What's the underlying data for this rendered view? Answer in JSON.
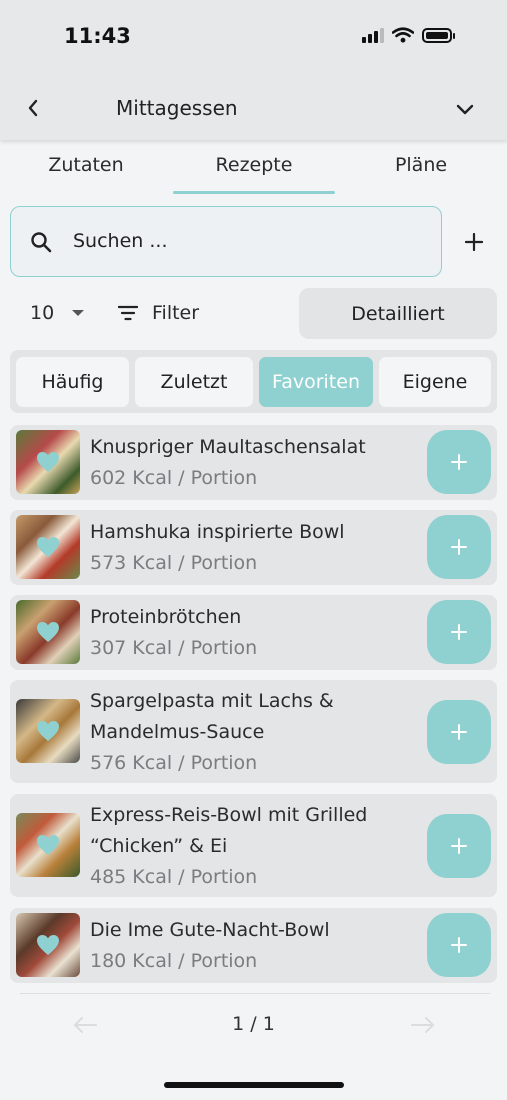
{
  "status": {
    "time": "11:43"
  },
  "header": {
    "title": "Mittagessen"
  },
  "tabs": [
    {
      "label": "Zutaten"
    },
    {
      "label": "Rezepte"
    },
    {
      "label": "Pläne"
    }
  ],
  "search": {
    "text": "Suchen ..."
  },
  "controls": {
    "count": "10",
    "filter_label": "Filter",
    "detail_label": "Detailliert"
  },
  "segments": [
    {
      "label": "Häufig"
    },
    {
      "label": "Zuletzt"
    },
    {
      "label": "Favoriten"
    },
    {
      "label": "Eigene"
    }
  ],
  "recipes": [
    {
      "name": "Knuspriger Maultaschensalat",
      "kcal": "602 Kcal / Portion"
    },
    {
      "name": "Hamshuka inspirierte Bowl",
      "kcal": "573 Kcal / Portion"
    },
    {
      "name": "Proteinbrötchen",
      "kcal": "307 Kcal / Portion"
    },
    {
      "name": "Spargelpasta mit Lachs & Mandelmus-Sauce",
      "kcal": "576 Kcal / Portion"
    },
    {
      "name": "Express-Reis-Bowl mit Grilled “Chicken” & Ei",
      "kcal": "485 Kcal / Portion"
    },
    {
      "name": "Die Ime Gute-Nacht-Bowl",
      "kcal": "180 Kcal / Portion"
    }
  ],
  "pagination": {
    "label": "1 / 1"
  },
  "colors": {
    "accent": "#8fd0d0",
    "card": "#e3e5e7",
    "background": "#f2f4f6"
  }
}
